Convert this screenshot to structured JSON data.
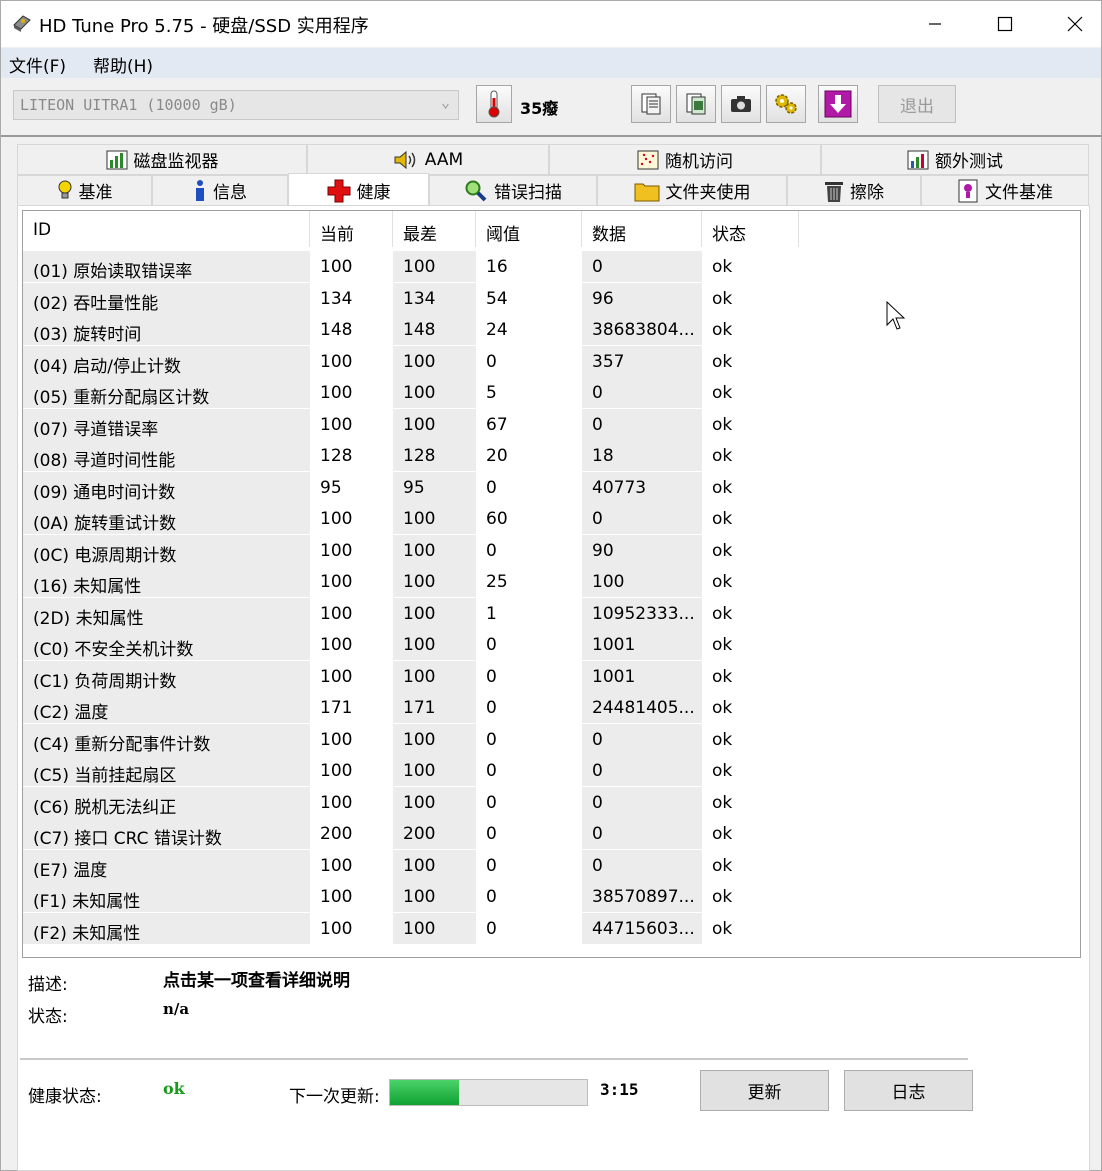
{
  "window": {
    "title": "HD Tune Pro 5.75 - 硬盘/SSD 实用程序"
  },
  "menu": {
    "file": "文件(F)",
    "help": "帮助(H)"
  },
  "toolbar": {
    "drive": "LITEON  UITRA1 (10000 gB)",
    "temperature": "35癈",
    "exit_label": "退出"
  },
  "tabs_top": [
    "磁盘监视器",
    "AAM",
    "随机访问",
    "额外测试"
  ],
  "tabs_bottom": [
    "基准",
    "信息",
    "健康",
    "错误扫描",
    "文件夹使用",
    "擦除",
    "文件基准"
  ],
  "active_tab": "健康",
  "table": {
    "headers": [
      "ID",
      "当前",
      "最差",
      "阈值",
      "数据",
      "状态"
    ],
    "rows": [
      [
        "(01) 原始读取错误率",
        "100",
        "100",
        "16",
        "0",
        "ok"
      ],
      [
        "(02) 吞吐量性能",
        "134",
        "134",
        "54",
        "96",
        "ok"
      ],
      [
        "(03) 旋转时间",
        "148",
        "148",
        "24",
        "38683804...",
        "ok"
      ],
      [
        "(04) 启动/停止计数",
        "100",
        "100",
        "0",
        "357",
        "ok"
      ],
      [
        "(05) 重新分配扇区计数",
        "100",
        "100",
        "5",
        "0",
        "ok"
      ],
      [
        "(07) 寻道错误率",
        "100",
        "100",
        "67",
        "0",
        "ok"
      ],
      [
        "(08) 寻道时间性能",
        "128",
        "128",
        "20",
        "18",
        "ok"
      ],
      [
        "(09) 通电时间计数",
        "95",
        "95",
        "0",
        "40773",
        "ok"
      ],
      [
        "(0A) 旋转重试计数",
        "100",
        "100",
        "60",
        "0",
        "ok"
      ],
      [
        "(0C) 电源周期计数",
        "100",
        "100",
        "0",
        "90",
        "ok"
      ],
      [
        "(16) 未知属性",
        "100",
        "100",
        "25",
        "100",
        "ok"
      ],
      [
        "(2D) 未知属性",
        "100",
        "100",
        "1",
        "10952333...",
        "ok"
      ],
      [
        "(C0) 不安全关机计数",
        "100",
        "100",
        "0",
        "1001",
        "ok"
      ],
      [
        "(C1) 负荷周期计数",
        "100",
        "100",
        "0",
        "1001",
        "ok"
      ],
      [
        "(C2) 温度",
        "171",
        "171",
        "0",
        "24481405...",
        "ok"
      ],
      [
        "(C4) 重新分配事件计数",
        "100",
        "100",
        "0",
        "0",
        "ok"
      ],
      [
        "(C5) 当前挂起扇区",
        "100",
        "100",
        "0",
        "0",
        "ok"
      ],
      [
        "(C6) 脱机无法纠正",
        "100",
        "100",
        "0",
        "0",
        "ok"
      ],
      [
        "(C7) 接口 CRC 错误计数",
        "200",
        "200",
        "0",
        "0",
        "ok"
      ],
      [
        "(E7) 温度",
        "100",
        "100",
        "0",
        "0",
        "ok"
      ],
      [
        "(F1) 未知属性",
        "100",
        "100",
        "0",
        "38570897...",
        "ok"
      ],
      [
        "(F2) 未知属性",
        "100",
        "100",
        "0",
        "44715603...",
        "ok"
      ]
    ]
  },
  "details": {
    "desc_label": "描述:",
    "desc_value": "点击某一项查看详细说明",
    "status_label": "状态:",
    "status_value": "n/a"
  },
  "footer": {
    "health_label": "健康状态:",
    "health_value": "ok",
    "next_update_label": "下一次更新:",
    "next_update_time": "3:15",
    "progress_fraction": 0.35,
    "refresh_label": "更新",
    "log_label": "日志"
  },
  "colors": {
    "ok_green": "#1a9a1a",
    "progress": "#10a131"
  }
}
